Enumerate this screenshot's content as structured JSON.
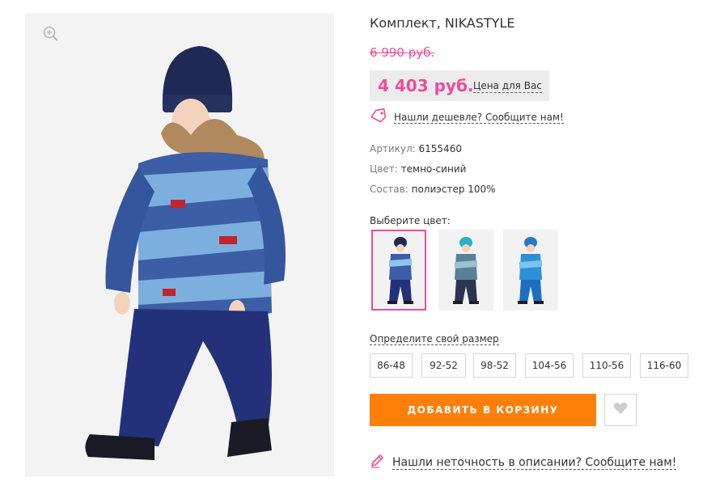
{
  "product": {
    "title": "Комплект, NIKASTYLE",
    "old_price": "6 990 руб.",
    "price": "4 403 руб.",
    "price_note": "Цена для Вас"
  },
  "cheaper_link": "Нашли дешевле? Сообщите нам!",
  "specs": [
    {
      "key": "Артикул:",
      "value": "6155460"
    },
    {
      "key": "Цвет:",
      "value": "темно-синий"
    },
    {
      "key": "Состав:",
      "value": "полиэстер 100%"
    }
  ],
  "color_picker": {
    "label": "Выберите цвет:",
    "selected_index": 0
  },
  "size_link": "Определите свой размер",
  "sizes": [
    "86-48",
    "92-52",
    "98-52",
    "104-56",
    "110-56",
    "116-60"
  ],
  "add_to_cart": "ДОБАВИТЬ В КОРЗИНУ",
  "inaccuracy_link": "Нашли неточность в описании? Сообщите нам!",
  "colors": {
    "accent_pink": "#ee4c9a",
    "button_orange": "#ff7f0a",
    "price_box_bg": "#ececec",
    "border_grey": "#d6d6d6"
  },
  "icons": {
    "zoom": "zoom-in-icon",
    "tag": "price-tag-icon",
    "heart": "heart-icon",
    "pencil": "pencil-icon"
  }
}
